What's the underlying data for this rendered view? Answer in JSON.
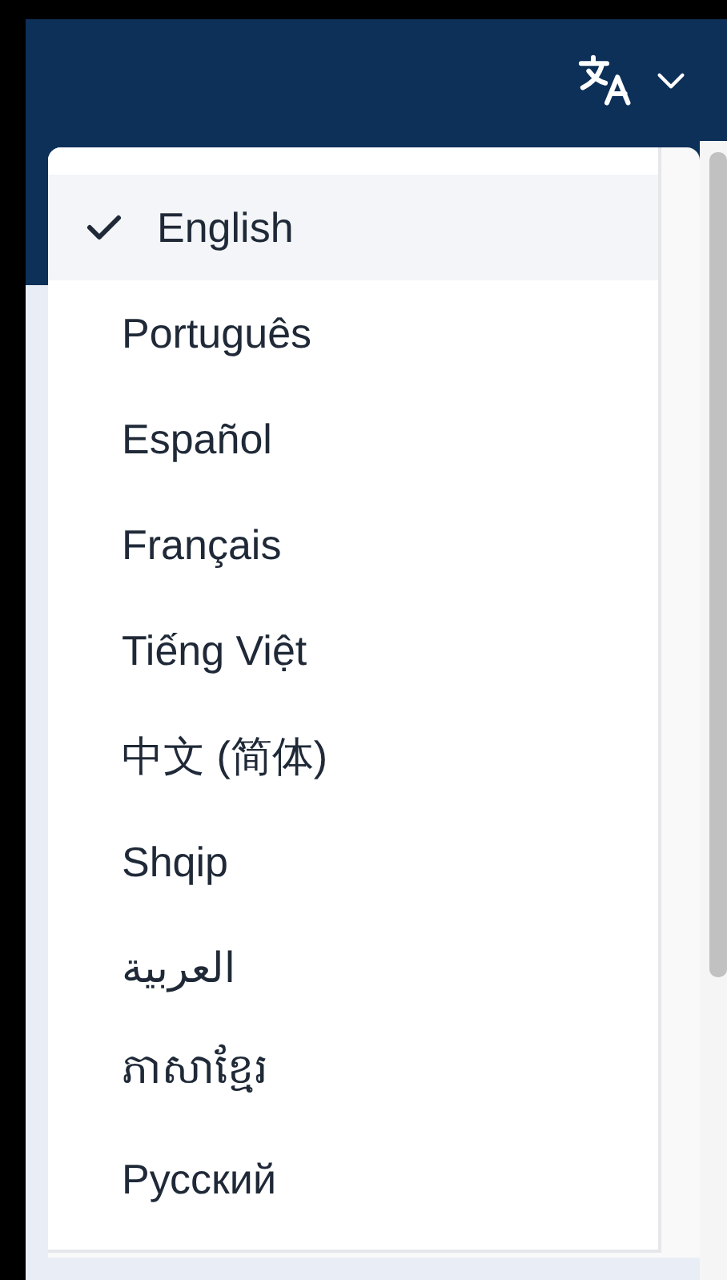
{
  "header": {
    "language_menu": {
      "expanded": true
    }
  },
  "languages": [
    {
      "label": "English",
      "selected": true
    },
    {
      "label": "Português",
      "selected": false
    },
    {
      "label": "Español",
      "selected": false
    },
    {
      "label": "Français",
      "selected": false
    },
    {
      "label": "Tiếng Việt",
      "selected": false
    },
    {
      "label": "中文 (简体)",
      "selected": false
    },
    {
      "label": "Shqip",
      "selected": false
    },
    {
      "label": "العربية",
      "selected": false
    },
    {
      "label": "ភាសាខ្មែរ",
      "selected": false
    },
    {
      "label": "Русский",
      "selected": false
    }
  ]
}
